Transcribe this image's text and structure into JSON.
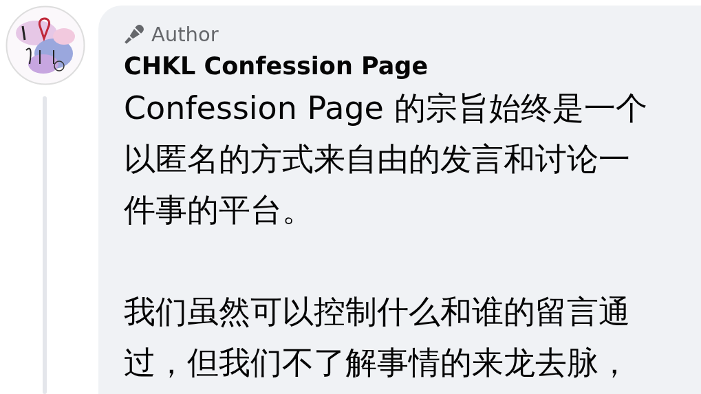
{
  "comment": {
    "badge": "Author",
    "author": "CHKL Confession Page",
    "paragraphs": [
      "Confession Page 的宗旨始终是一个以匿名的方式来自由的发言和讨论一件事的平台。",
      "我们虽然可以控制什么和谁的留言通过，但我们不了解事情的来龙去脉，"
    ]
  }
}
